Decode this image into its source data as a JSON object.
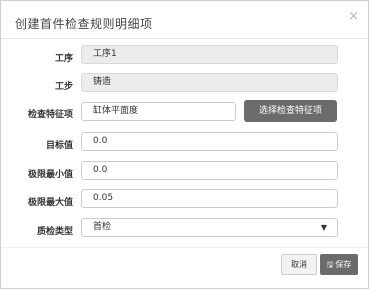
{
  "dialog": {
    "title": "创建首件检查规则明细项",
    "close_icon": "×"
  },
  "form": {
    "process_label": "工序",
    "process_value": "工序1",
    "step_label": "工步",
    "step_value": "铸造",
    "feature_label": "检查特征项",
    "feature_value": "缸体平面度",
    "pick_feature_button": "选择检查特征项",
    "target_label": "目标值",
    "target_value": "0.0",
    "min_label": "极限最小值",
    "min_value": "0.0",
    "max_label": "极限最大值",
    "max_value": "0.05",
    "qc_type_label": "质检类型",
    "qc_type_value": "首检",
    "qc_type_arrow": "▼"
  },
  "footer": {
    "cancel_label": "取消",
    "save_icon": "🖫",
    "save_label": "保存"
  }
}
